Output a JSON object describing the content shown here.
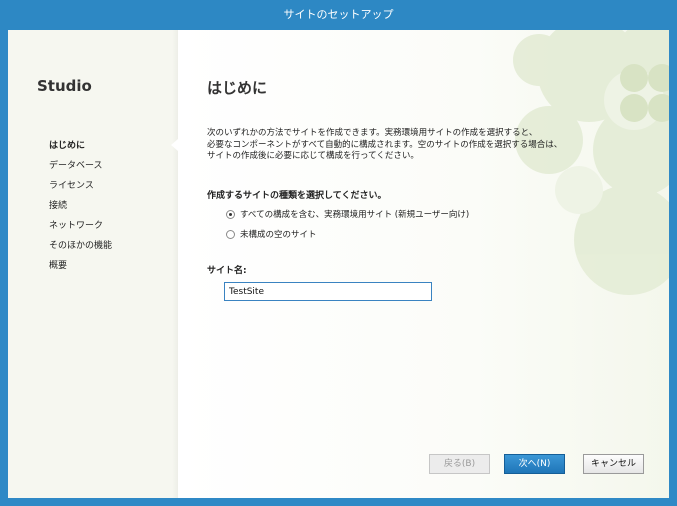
{
  "window": {
    "title": "サイトのセットアップ"
  },
  "sidebar": {
    "brand": "Studio",
    "items": [
      {
        "label": "はじめに",
        "active": true
      },
      {
        "label": "データベース",
        "active": false
      },
      {
        "label": "ライセンス",
        "active": false
      },
      {
        "label": "接続",
        "active": false
      },
      {
        "label": "ネットワーク",
        "active": false
      },
      {
        "label": "そのほかの機能",
        "active": false
      },
      {
        "label": "概要",
        "active": false
      }
    ]
  },
  "main": {
    "heading": "はじめに",
    "description": [
      "次のいずれかの方法でサイトを作成できます。実務環境用サイトの作成を選択すると、",
      "必要なコンポーネントがすべて自動的に構成されます。空のサイトの作成を選択する場合は、",
      "サイトの作成後に必要に応じて構成を行ってください。"
    ],
    "site_type_question": "作成するサイトの種類を選択してください。",
    "options": [
      {
        "label": "すべての構成を含む、実務環境用サイト (新規ユーザー向け)",
        "selected": true
      },
      {
        "label": "未構成の空のサイト",
        "selected": false
      }
    ],
    "site_name_label": "サイト名:",
    "site_name_value": "TestSite"
  },
  "buttons": {
    "back": "戻る(B)",
    "next": "次へ(N)",
    "cancel": "キャンセル"
  },
  "colors": {
    "titlebar": "#2d88c4",
    "accent": "#1f75b8",
    "decoration": "#e3ebd3"
  }
}
